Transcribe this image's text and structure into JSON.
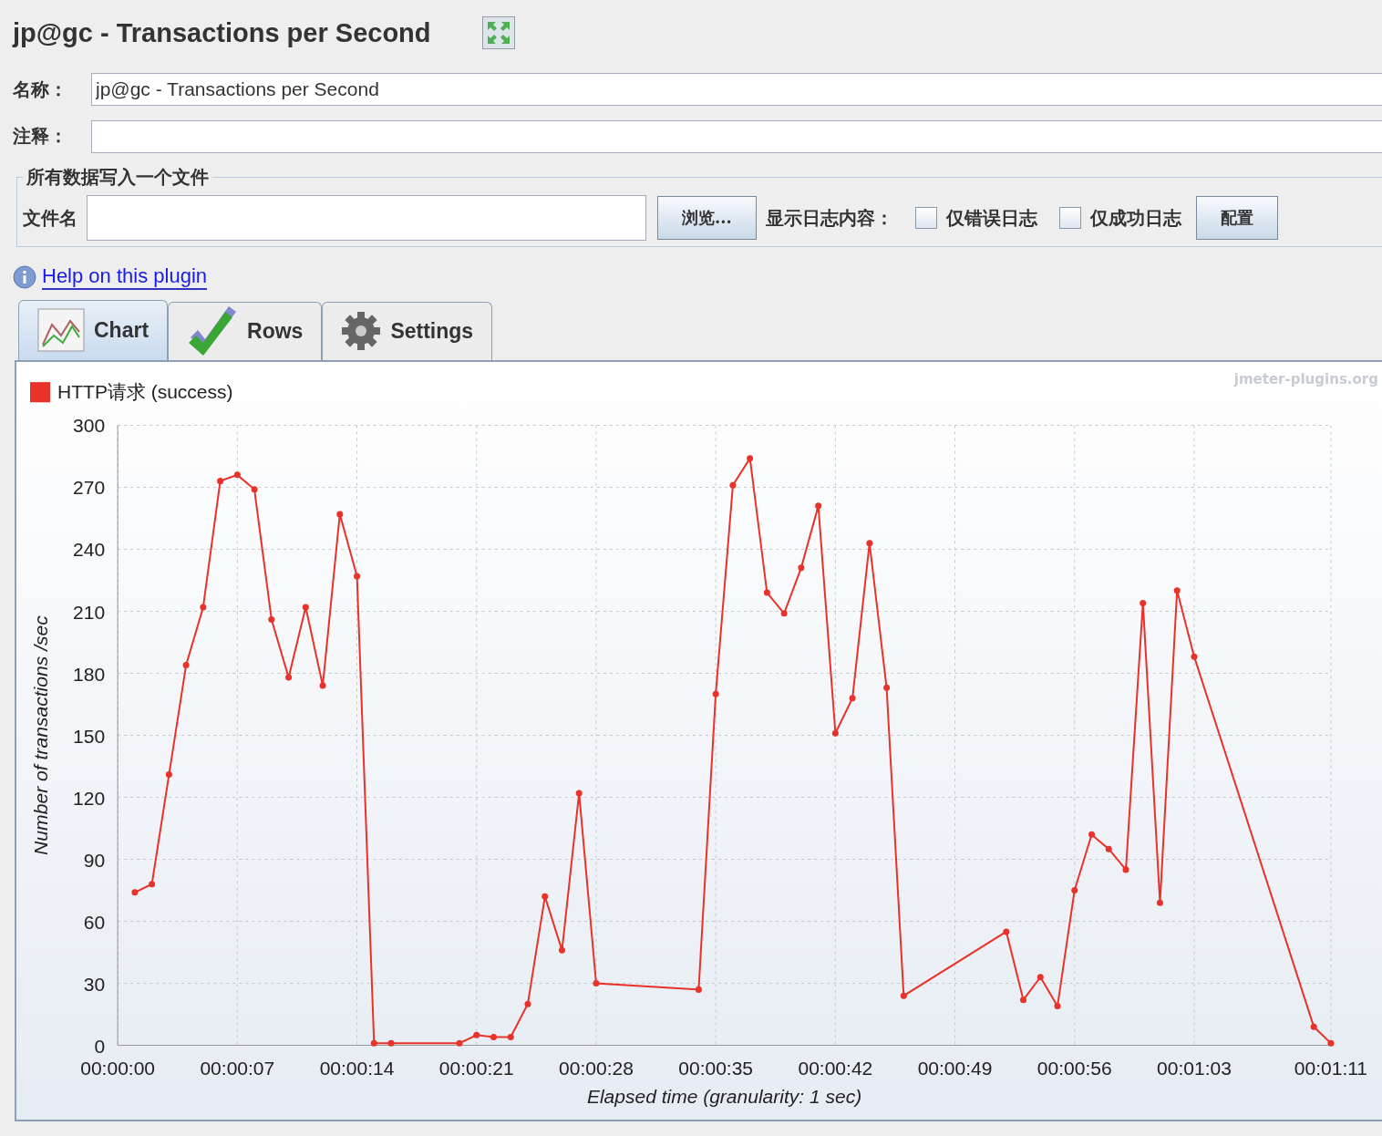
{
  "title": "jp@gc - Transactions per Second",
  "name_field": {
    "label": "名称：",
    "value": "jp@gc - Transactions per Second"
  },
  "comment_field": {
    "label": "注释："
  },
  "file_group": {
    "title": "所有数据写入一个文件",
    "file_label": "文件名",
    "browse_button": "浏览...",
    "log_label": "显示日志内容：",
    "checkboxes": [
      {
        "label": "仅错误日志",
        "checked": false
      },
      {
        "label": "仅成功日志",
        "checked": false
      }
    ],
    "config_button": "配置"
  },
  "help_link": "Help on this plugin",
  "tabs": [
    {
      "label": "Chart",
      "kind": "chart",
      "selected": true
    },
    {
      "label": "Rows",
      "kind": "rows",
      "selected": false
    },
    {
      "label": "Settings",
      "kind": "settings",
      "selected": false
    }
  ],
  "chart": {
    "watermark": "jmeter-plugins.org",
    "chart_data": {
      "type": "line",
      "xlabel": "Elapsed time (granularity: 1 sec)",
      "ylabel": "Number of transactions /sec",
      "grid": true,
      "xlim": [
        0,
        71
      ],
      "ylim": [
        0,
        300
      ],
      "xticks": [
        {
          "value": 0,
          "label": "00:00:00"
        },
        {
          "value": 7,
          "label": "00:00:07"
        },
        {
          "value": 14,
          "label": "00:00:14"
        },
        {
          "value": 21,
          "label": "00:00:21"
        },
        {
          "value": 28,
          "label": "00:00:28"
        },
        {
          "value": 35,
          "label": "00:00:35"
        },
        {
          "value": 42,
          "label": "00:00:42"
        },
        {
          "value": 49,
          "label": "00:00:49"
        },
        {
          "value": 56,
          "label": "00:00:56"
        },
        {
          "value": 63,
          "label": "00:01:03"
        },
        {
          "value": 71,
          "label": "00:01:11"
        }
      ],
      "yticks": [
        0,
        30,
        60,
        90,
        120,
        150,
        180,
        210,
        240,
        270,
        300
      ],
      "x": [
        1,
        2,
        3,
        4,
        5,
        6,
        7,
        8,
        9,
        10,
        11,
        12,
        13,
        14,
        15,
        16,
        20,
        21,
        22,
        23,
        24,
        25,
        26,
        27,
        28,
        34,
        35,
        36,
        37,
        38,
        39,
        40,
        41,
        42,
        43,
        44,
        45,
        46,
        52,
        53,
        54,
        55,
        56,
        57,
        58,
        59,
        60,
        61,
        62,
        63,
        70,
        71
      ],
      "series": [
        {
          "name": "HTTP请求 (success)",
          "color": "#e8322a",
          "marker": "circle",
          "values": [
            74,
            78,
            131,
            184,
            212,
            273,
            276,
            269,
            206,
            178,
            212,
            174,
            257,
            227,
            1,
            1,
            1,
            5,
            4,
            4,
            20,
            72,
            46,
            122,
            30,
            27,
            170,
            271,
            284,
            219,
            209,
            231,
            261,
            151,
            168,
            243,
            173,
            24,
            55,
            22,
            33,
            19,
            75,
            102,
            95,
            85,
            214,
            69,
            220,
            188,
            9,
            1
          ]
        }
      ]
    }
  }
}
